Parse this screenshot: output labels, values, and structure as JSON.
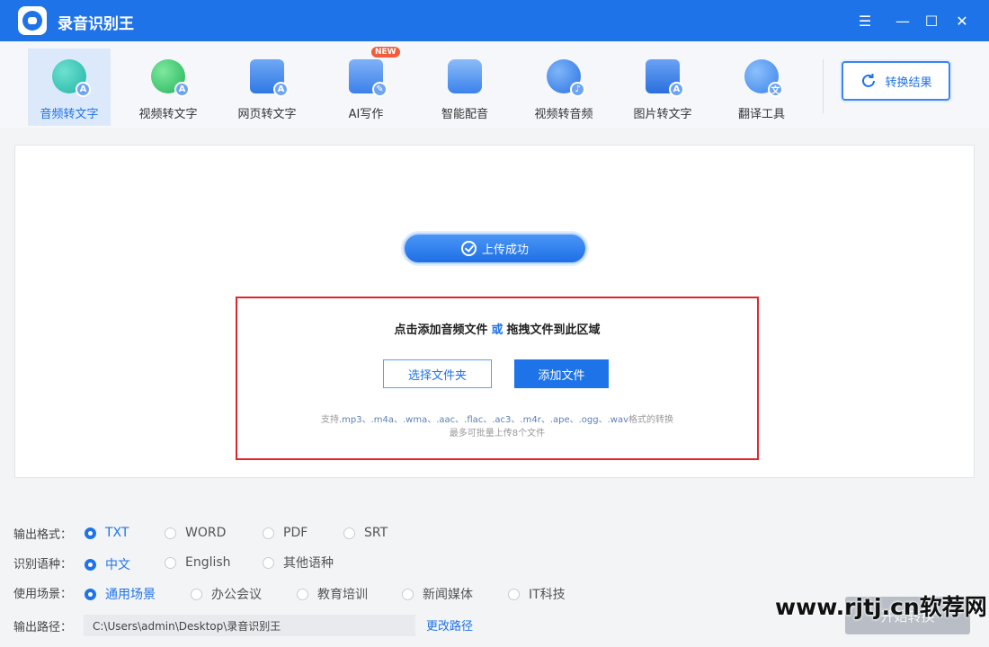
{
  "app": {
    "title": "录音识别王"
  },
  "window_controls": {
    "menu": "☰",
    "minimize": "—",
    "maximize": "☐",
    "close": "✕"
  },
  "toolbar": {
    "tools": [
      {
        "label": "音频转文字",
        "icon": "audio-to-text-icon",
        "active": true
      },
      {
        "label": "视频转文字",
        "icon": "video-to-text-icon"
      },
      {
        "label": "网页转文字",
        "icon": "webpage-to-text-icon"
      },
      {
        "label": "AI写作",
        "icon": "ai-writing-icon",
        "badge": "NEW"
      },
      {
        "label": "智能配音",
        "icon": "smart-dubbing-icon"
      },
      {
        "label": "视频转音频",
        "icon": "video-to-audio-icon"
      },
      {
        "label": "图片转文字",
        "icon": "image-to-text-icon"
      },
      {
        "label": "翻译工具",
        "icon": "translate-tool-icon"
      }
    ],
    "result_button": "转换结果"
  },
  "upload": {
    "status": "上传成功",
    "drop_title_a": "点击添加音频文件",
    "drop_title_or": "或",
    "drop_title_b": "拖拽文件到此区域",
    "select_folder": "选择文件夹",
    "add_file": "添加文件",
    "support_prefix": "支持",
    "support_formats": ".mp3、.m4a、.wma、.aac、.flac、.ac3、.m4r、.ape、.ogg、.wav",
    "support_suffix": "格式的转换",
    "support_limit": "最多可批量上传8个文件"
  },
  "options": {
    "output_format": {
      "label": "输出格式：",
      "choices": [
        "TXT",
        "WORD",
        "PDF",
        "SRT"
      ],
      "selected": "TXT"
    },
    "language": {
      "label": "识别语种：",
      "choices": [
        "中文",
        "English",
        "其他语种"
      ],
      "selected": "中文"
    },
    "scene": {
      "label": "使用场景：",
      "choices": [
        "通用场景",
        "办公会议",
        "教育培训",
        "新闻媒体",
        "IT科技"
      ],
      "selected": "通用场景"
    },
    "output_path": {
      "label": "输出路径：",
      "value": "C:\\Users\\admin\\Desktop\\录音识别王",
      "change": "更改路径"
    }
  },
  "start_button": "开始转换",
  "watermark": "www.rjtj.cn软荐网",
  "colors": {
    "primary": "#1f73e8",
    "highlight_border": "#e3242b",
    "toolbar_bg": "#f5f7fb"
  }
}
